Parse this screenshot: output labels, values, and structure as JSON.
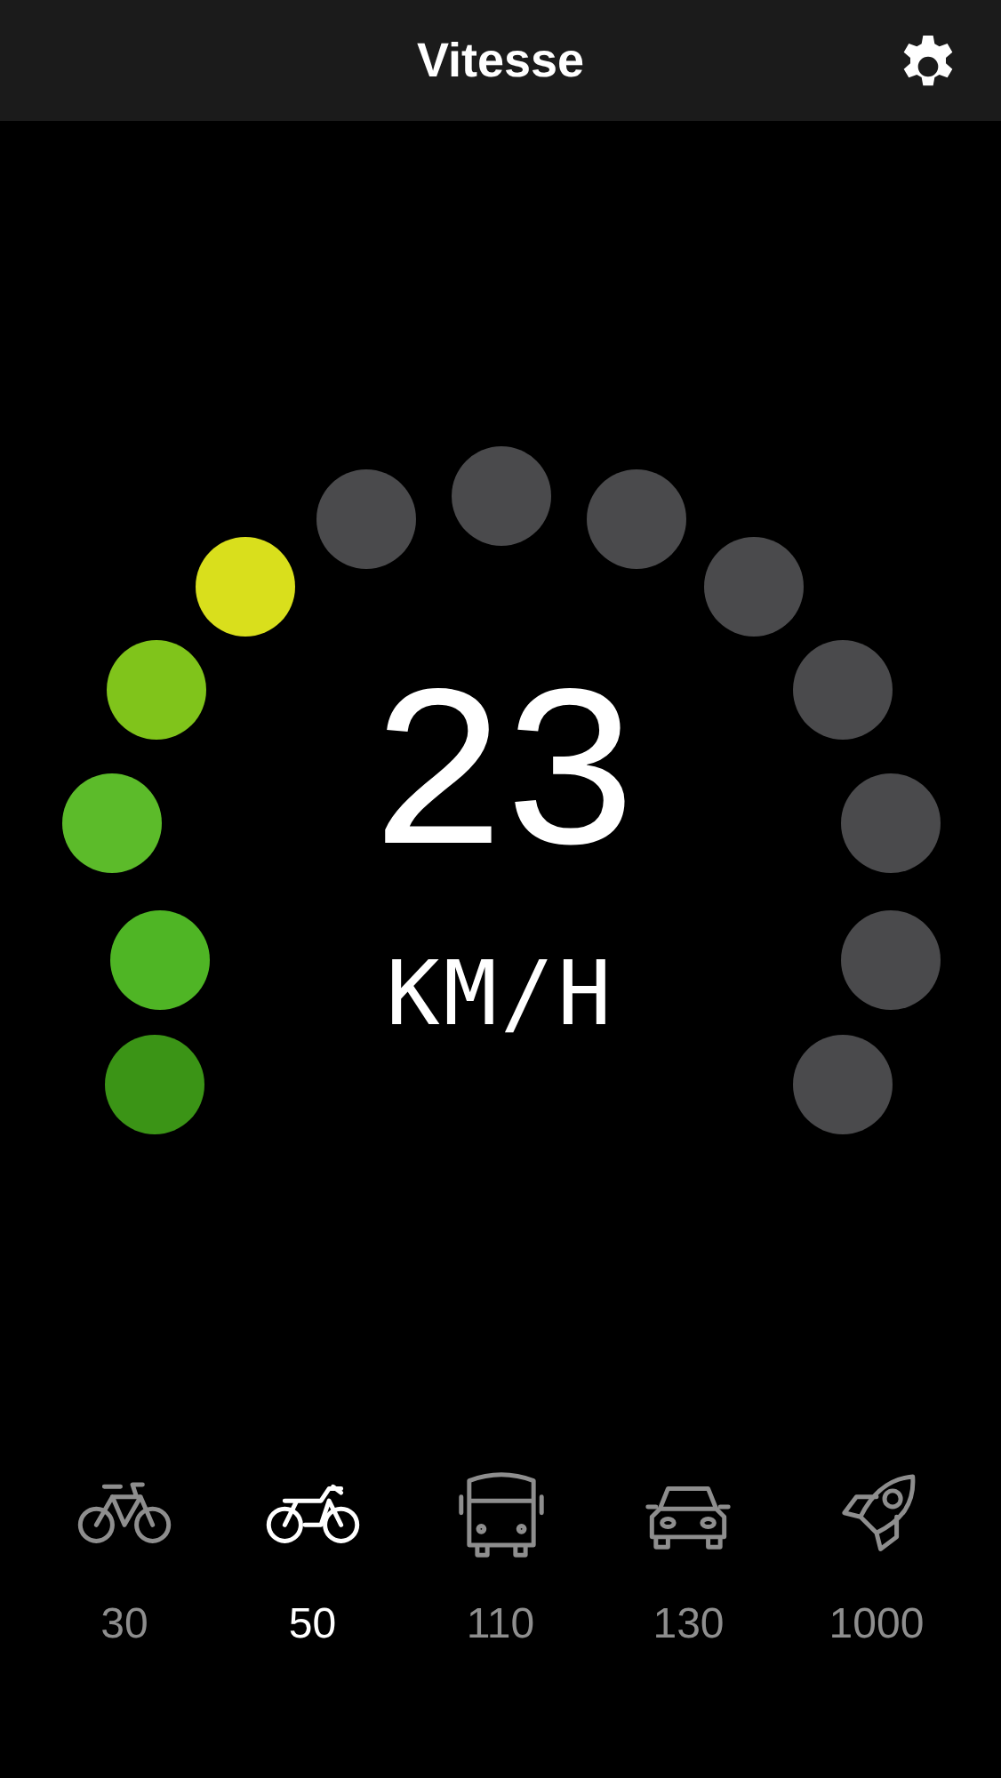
{
  "header": {
    "title": "Vitesse"
  },
  "gauge": {
    "dots": [
      {
        "color": "#3b9416"
      },
      {
        "color": "#4fb525"
      },
      {
        "color": "#5cbb2a"
      },
      {
        "color": "#80c41b"
      },
      {
        "color": "#d9df1c"
      },
      {
        "color": "#4a4a4c"
      },
      {
        "color": "#4a4a4c"
      },
      {
        "color": "#4a4a4c"
      },
      {
        "color": "#4a4a4c"
      },
      {
        "color": "#4a4a4c"
      },
      {
        "color": "#4a4a4c"
      },
      {
        "color": "#4a4a4c"
      },
      {
        "color": "#4a4a4c"
      }
    ],
    "speed": "23",
    "unit": "KM/H"
  },
  "vehicles": [
    {
      "kind": "bicycle",
      "limit": "30",
      "selected": false
    },
    {
      "kind": "motorcycle",
      "limit": "50",
      "selected": true
    },
    {
      "kind": "bus",
      "limit": "110",
      "selected": false
    },
    {
      "kind": "car",
      "limit": "130",
      "selected": false
    },
    {
      "kind": "rocket",
      "limit": "1000",
      "selected": false
    }
  ]
}
